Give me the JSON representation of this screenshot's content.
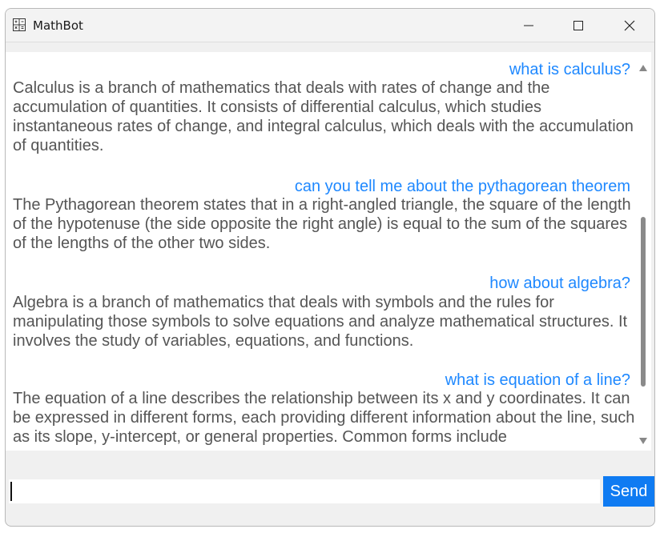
{
  "window": {
    "title": "MathBot",
    "icon": "calculator-icon"
  },
  "titlebar_buttons": {
    "minimize": "minimize-icon",
    "maximize": "maximize-icon",
    "close": "close-icon"
  },
  "chat": {
    "messages": [
      {
        "role": "user",
        "text": "what is calculus?"
      },
      {
        "role": "bot",
        "text": "Calculus is a branch of mathematics that deals with rates of change and the accumulation of quantities. It consists of differential calculus, which studies instantaneous rates of change, and integral calculus, which deals with the accumulation of quantities."
      },
      {
        "role": "user",
        "text": "can you tell me about the pythagorean theorem"
      },
      {
        "role": "bot",
        "text": "The Pythagorean theorem states that in a right-angled triangle, the square of the length of the hypotenuse (the side opposite the right angle) is equal to the sum of the squares of the lengths of the other two sides."
      },
      {
        "role": "user",
        "text": "how about algebra?"
      },
      {
        "role": "bot",
        "text": "Algebra is a branch of mathematics that deals with symbols and the rules for manipulating those symbols to solve equations and analyze mathematical structures. It involves the study of variables, equations, and functions."
      },
      {
        "role": "user",
        "text": "what is equation of a line?"
      },
      {
        "role": "bot",
        "text": "The equation of a line describes the relationship between its x and y coordinates. It can be expressed in different forms, each providing different information about the line, such as its slope, y-intercept, or general properties. Common forms include"
      }
    ]
  },
  "input": {
    "value": "",
    "send_label": "Send"
  },
  "colors": {
    "user_text": "#1e88ff",
    "bot_text": "#555555",
    "send_button": "#0f7bf2"
  }
}
